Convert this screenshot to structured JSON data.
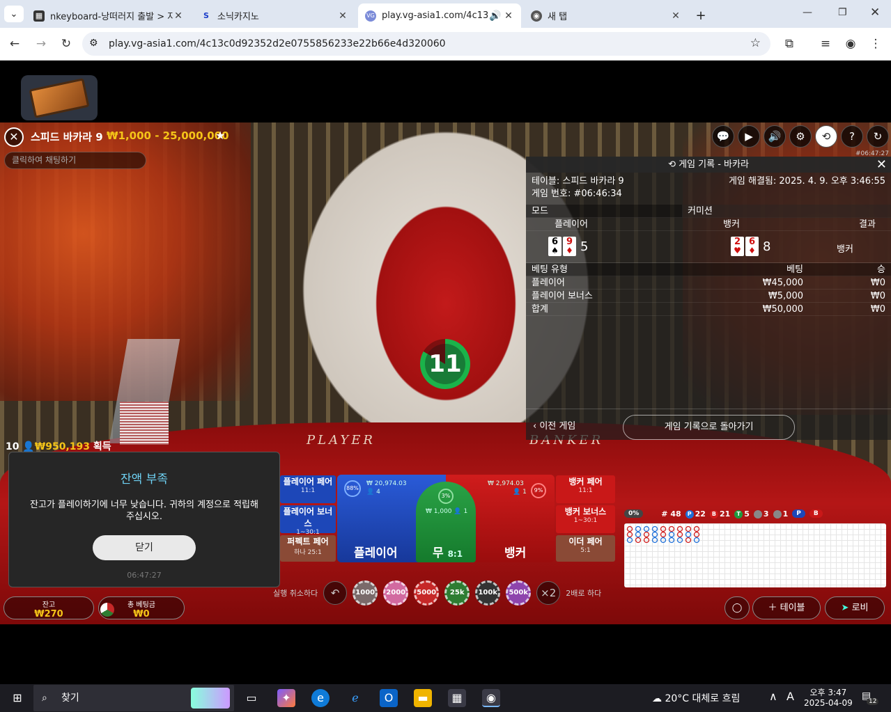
{
  "browser": {
    "tabs": [
      {
        "title": "nkeyboard-낭떠러지 출발 > 자",
        "close": "✕"
      },
      {
        "title": "소닉카지노",
        "close": "✕"
      },
      {
        "title": "play.vg-asia1.com/4c13c0d",
        "close": "✕"
      },
      {
        "title": "새 탭",
        "close": "✕"
      }
    ],
    "new_tab": "+",
    "url": "play.vg-asia1.com/4c13c0d92352d2e0755856233e22b66e4d320060"
  },
  "game": {
    "table_name": "스피드 바카라 9",
    "limits": "₩1,000 - 25,000,000",
    "chat_placeholder": "클릭하여 채팅하기",
    "round_id": "#06:47:27",
    "timer": "11",
    "table_player_label": "PLAYER",
    "table_banker_label": "BANKER",
    "win_info": {
      "count": "10",
      "amount": "₩950,193",
      "suffix": "획득"
    }
  },
  "history": {
    "title": "게임 기록 - 바카라",
    "table_line": "테이블: 스피드 바카라 9",
    "game_no": "게임 번호: #06:46:34",
    "settled": "게임 해결됨: 2025. 4. 9. 오후 3:46:55",
    "mode_label": "모드",
    "commission_label": "커미션",
    "col_player": "플레이어",
    "col_banker": "뱅커",
    "col_result": "결과",
    "player_cards": [
      {
        "rank": "6",
        "suit": "♠",
        "red": false
      },
      {
        "rank": "9",
        "suit": "♦",
        "red": true
      }
    ],
    "player_score": "5",
    "banker_cards": [
      {
        "rank": "2",
        "suit": "♥",
        "red": true
      },
      {
        "rank": "6",
        "suit": "♦",
        "red": true
      }
    ],
    "banker_score": "8",
    "result": "뱅커",
    "bet_head": {
      "type": "베팅 유형",
      "bet": "베팅",
      "win": "승"
    },
    "bets": [
      {
        "type": "플레이어",
        "bet": "₩45,000",
        "win": "₩0"
      },
      {
        "type": "플레이어 보너스",
        "bet": "₩5,000",
        "win": "₩0"
      },
      {
        "type": "합계",
        "bet": "₩50,000",
        "win": "₩0"
      }
    ],
    "prev_game": "이전 게임",
    "back": "게임 기록으로 돌아가기"
  },
  "bets": {
    "player_pair": {
      "label": "플레이어 페어",
      "odds": "11:1"
    },
    "player_bonus": {
      "label": "플레이어 보너스",
      "odds": "1~30:1"
    },
    "perfect_pair": {
      "label": "퍼펙트 페어",
      "odds": "하나 25:1"
    },
    "banker_pair": {
      "label": "뱅커 페어",
      "odds": "11:1"
    },
    "banker_bonus": {
      "label": "뱅커 보너스",
      "odds": "1~30:1"
    },
    "either_pair": {
      "label": "이더 페어",
      "odds": "5:1"
    },
    "player": {
      "label": "플레이어",
      "pct": "88%",
      "amount": "₩ 20,974.03",
      "people": "4"
    },
    "tie": {
      "label": "무",
      "odds": "8:1",
      "pct": "3%",
      "amount": "₩ 1,000",
      "people": "1"
    },
    "banker": {
      "label": "뱅커",
      "pct": "9%",
      "amount": "₩ 2,974.03",
      "people": "1"
    }
  },
  "chips": {
    "undo_label": "실행 취소하다",
    "values": [
      "1000",
      "2000",
      "5000",
      "25k",
      "100k",
      "500k"
    ],
    "double": "×2",
    "double_label": "2배로 하다"
  },
  "wallet": {
    "balance_label": "잔고",
    "balance": "₩270",
    "total_bet_label": "총 베팅금",
    "total_bet": "₩0"
  },
  "modal": {
    "title": "잔액 부족",
    "message": "잔고가 플레이하기에 너무 낮습니다. 귀하의 계정으로 적립해 주십시오.",
    "button": "닫기",
    "time": "06:47:27"
  },
  "roadmap": {
    "pct": "0%",
    "total": "# 48",
    "player_count": "22",
    "banker_count": "21",
    "tie_count": "5",
    "p_pair": "3",
    "b_pair": "1",
    "p_label": "P",
    "b_label": "B",
    "t_label": "T"
  },
  "bottom": {
    "table_btn": "테이블",
    "lobby_btn": "로비"
  },
  "taskbar": {
    "search": "찾기",
    "weather": "20°C  대체로 흐림",
    "time": "오후 3:47",
    "date": "2025-04-09",
    "notif": "12",
    "ime": "A"
  },
  "colors": {
    "accent_gold": "#f5c518",
    "player_blue": "#2a5bd8",
    "banker_red": "#d01c1c",
    "tie_green": "#2aa246"
  }
}
